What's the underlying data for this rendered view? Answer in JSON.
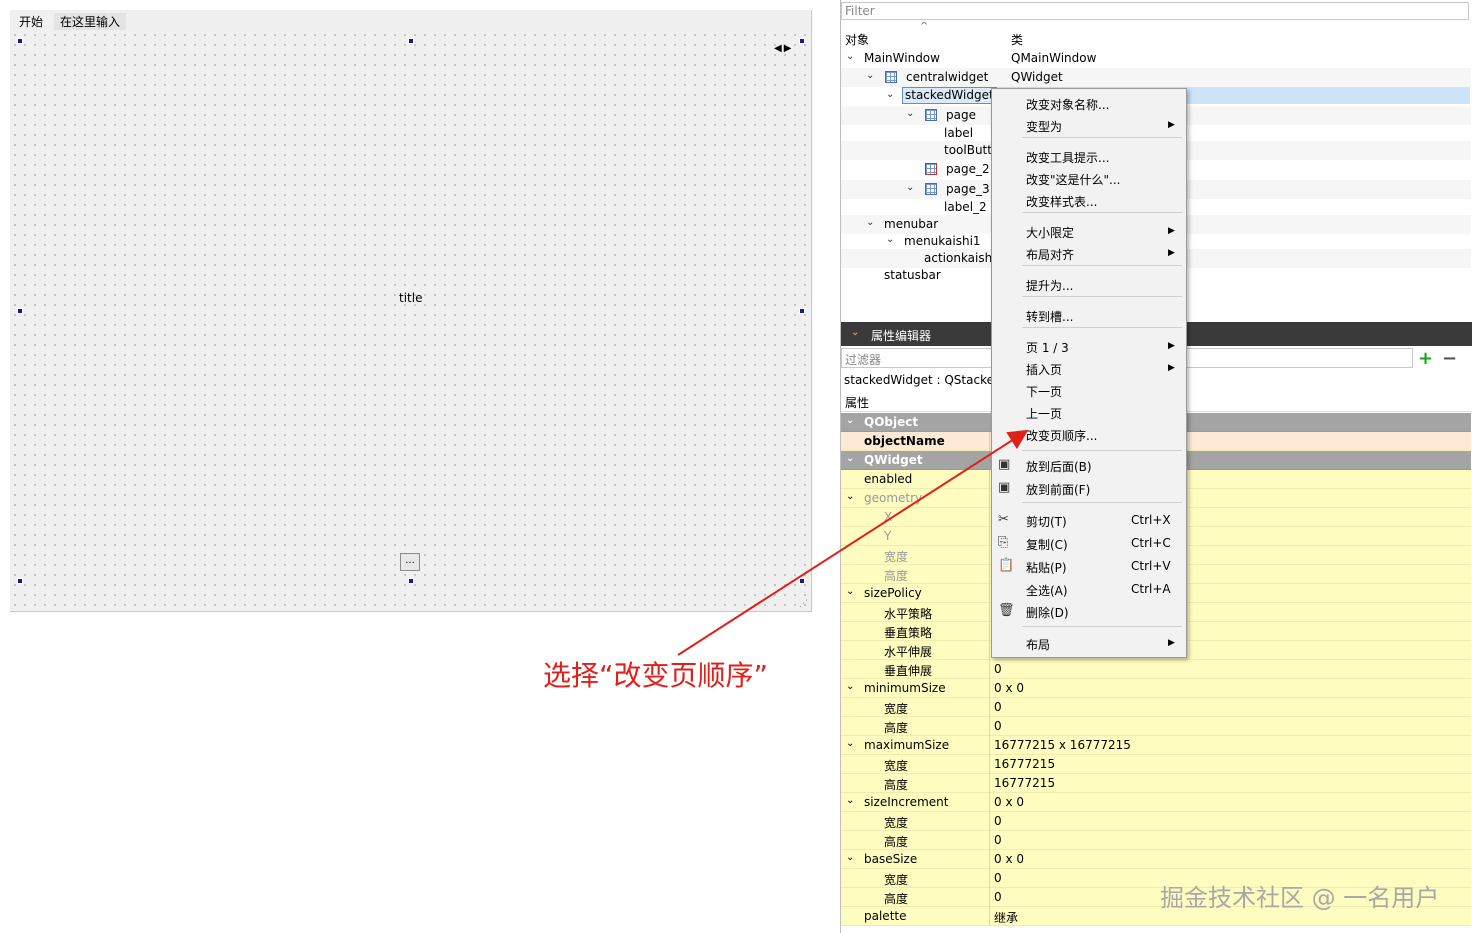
{
  "designer": {
    "menu": [
      "开始",
      "在这里输入"
    ],
    "title_label": "title",
    "tool_button_text": "...",
    "nav_arrows": "◀▶"
  },
  "object_inspector": {
    "filter_placeholder": "Filter",
    "col_object": "对象",
    "col_class": "类",
    "sort_indicator": "^",
    "tree": [
      {
        "name": "MainWindow",
        "class": "QMainWindow"
      },
      {
        "name": "centralwidget",
        "class": "QWidget"
      },
      {
        "name": "stackedWidget",
        "class": ""
      },
      {
        "name": "page",
        "class": ""
      },
      {
        "name": "label",
        "class": ""
      },
      {
        "name": "toolButt",
        "class": ""
      },
      {
        "name": "page_2",
        "class": ""
      },
      {
        "name": "page_3",
        "class": ""
      },
      {
        "name": "label_2",
        "class": ""
      },
      {
        "name": "menubar",
        "class": ""
      },
      {
        "name": "menukaishi1",
        "class": ""
      },
      {
        "name": "actionkaishi",
        "class": ""
      },
      {
        "name": "statusbar",
        "class": ""
      }
    ]
  },
  "property_editor": {
    "title": "属性编辑器",
    "filter_placeholder": "过滤器",
    "object_class": "stackedWidget : QStacke",
    "col_property": "属性",
    "rows": [
      {
        "name": "QObject",
        "value": ""
      },
      {
        "name": "objectName",
        "value": ""
      },
      {
        "name": "QWidget",
        "value": ""
      },
      {
        "name": "enabled",
        "value": ""
      },
      {
        "name": "geometry",
        "value": ""
      },
      {
        "name": "X",
        "value": ""
      },
      {
        "name": "Y",
        "value": ""
      },
      {
        "name": "宽度",
        "value": ""
      },
      {
        "name": "高度",
        "value": ""
      },
      {
        "name": "sizePolicy",
        "value": ""
      },
      {
        "name": "水平策略",
        "value": ""
      },
      {
        "name": "垂直策略",
        "value": ""
      },
      {
        "name": "水平伸展",
        "value": ""
      },
      {
        "name": "垂直伸展",
        "value": "0"
      },
      {
        "name": "minimumSize",
        "value": "0 x 0"
      },
      {
        "name": "宽度",
        "value": "0"
      },
      {
        "name": "高度",
        "value": "0"
      },
      {
        "name": "maximumSize",
        "value": "16777215 x 16777215"
      },
      {
        "name": "宽度",
        "value": "16777215"
      },
      {
        "name": "高度",
        "value": "16777215"
      },
      {
        "name": "sizeIncrement",
        "value": "0 x 0"
      },
      {
        "name": "宽度",
        "value": "0"
      },
      {
        "name": "高度",
        "value": "0"
      },
      {
        "name": "baseSize",
        "value": "0 x 0"
      },
      {
        "name": "宽度",
        "value": "0"
      },
      {
        "name": "高度",
        "value": "0"
      },
      {
        "name": "palette",
        "value": "继承"
      }
    ]
  },
  "context_menu": {
    "items": [
      {
        "label": "改变对象名称...",
        "shortcut": ""
      },
      {
        "label": "变型为",
        "shortcut": ""
      },
      {
        "label": "改变工具提示...",
        "shortcut": ""
      },
      {
        "label": "改变\"这是什么\"...",
        "shortcut": ""
      },
      {
        "label": "改变样式表...",
        "shortcut": ""
      },
      {
        "label": "大小限定",
        "shortcut": ""
      },
      {
        "label": "布局对齐",
        "shortcut": ""
      },
      {
        "label": "提升为...",
        "shortcut": ""
      },
      {
        "label": "转到槽...",
        "shortcut": ""
      },
      {
        "label": "页 1 / 3",
        "shortcut": ""
      },
      {
        "label": "插入页",
        "shortcut": ""
      },
      {
        "label": "下一页",
        "shortcut": ""
      },
      {
        "label": "上一页",
        "shortcut": ""
      },
      {
        "label": "改变页顺序...",
        "shortcut": ""
      },
      {
        "label": "放到后面(B)",
        "shortcut": ""
      },
      {
        "label": "放到前面(F)",
        "shortcut": ""
      },
      {
        "label": "剪切(T)",
        "shortcut": "Ctrl+X"
      },
      {
        "label": "复制(C)",
        "shortcut": "Ctrl+C"
      },
      {
        "label": "粘贴(P)",
        "shortcut": "Ctrl+V"
      },
      {
        "label": "全选(A)",
        "shortcut": "Ctrl+A"
      },
      {
        "label": "删除(D)",
        "shortcut": ""
      },
      {
        "label": "布局",
        "shortcut": ""
      }
    ]
  },
  "annotation": "选择“改变页顺序”",
  "watermark": "掘金技术社区 @ 一名用户",
  "colors": {
    "annotation": "#e0201a",
    "selection": "#cde3f7",
    "group_row": "#a4a4a4",
    "property_bg": "#fffcc0"
  }
}
